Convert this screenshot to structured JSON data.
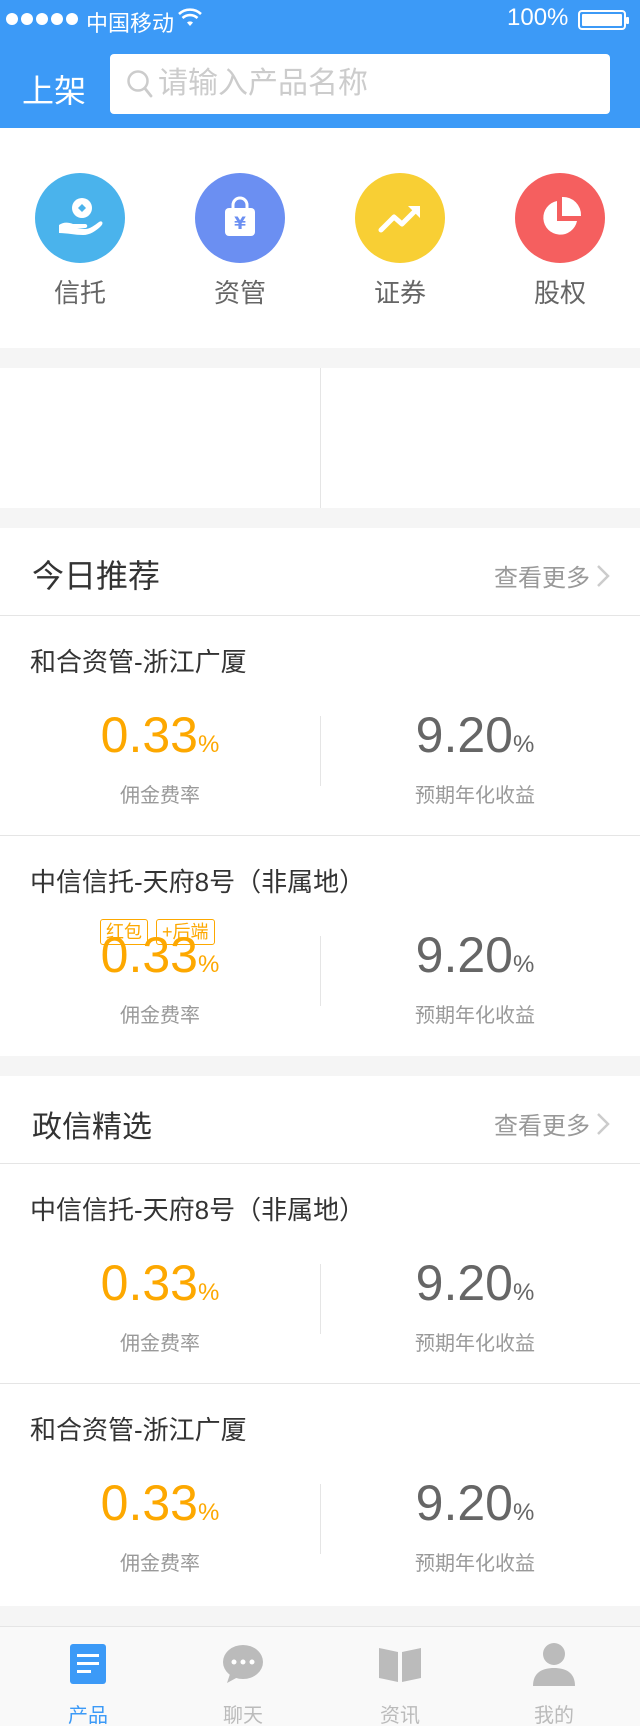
{
  "status_bar": {
    "carrier": "中国移动",
    "battery": "100%"
  },
  "header": {
    "title": "上架",
    "search_placeholder": "请输入产品名称"
  },
  "categories": [
    {
      "label": "信托",
      "icon": "hand-coin-icon",
      "color": "#4ab3ec"
    },
    {
      "label": "资管",
      "icon": "money-bag-icon",
      "color": "#6b8ff2"
    },
    {
      "label": "证券",
      "icon": "trend-up-icon",
      "color": "#f8cf34"
    },
    {
      "label": "股权",
      "icon": "pie-chart-icon",
      "color": "#f55f5f"
    }
  ],
  "recommend": {
    "title": "今日推荐",
    "more": "查看更多",
    "items": [
      {
        "name": "和合资管-浙江广厦",
        "rate": "0.33",
        "rate_unit": "%",
        "rate_label": "佣金费率",
        "yield": "9.20",
        "yield_unit": "%",
        "yield_label": "预期年化收益"
      },
      {
        "name": "中信信托-天府8号（非属地）",
        "tags": [
          "红包",
          "+后端"
        ],
        "rate": "0.33",
        "rate_unit": "%",
        "rate_label": "佣金费率",
        "yield": "9.20",
        "yield_unit": "%",
        "yield_label": "预期年化收益"
      }
    ]
  },
  "selection": {
    "title": "政信精选",
    "more": "查看更多",
    "items": [
      {
        "name": "中信信托-天府8号（非属地）",
        "rate": "0.33",
        "rate_unit": "%",
        "rate_label": "佣金费率",
        "yield": "9.20",
        "yield_unit": "%",
        "yield_label": "预期年化收益"
      },
      {
        "name": "和合资管-浙江广厦",
        "rate": "0.33",
        "rate_unit": "%",
        "rate_label": "佣金费率",
        "yield": "9.20",
        "yield_unit": "%",
        "yield_label": "预期年化收益"
      }
    ]
  },
  "tabbar": {
    "items": [
      {
        "label": "产品",
        "icon": "document-icon",
        "active": true
      },
      {
        "label": "聊天",
        "icon": "chat-icon",
        "active": false
      },
      {
        "label": "资讯",
        "icon": "book-icon",
        "active": false
      },
      {
        "label": "我的",
        "icon": "user-icon",
        "active": false
      }
    ]
  },
  "colors": {
    "primary": "#3c9af7",
    "accent": "#fda800",
    "divider": "#e5e5e5",
    "text": "#333333",
    "muted": "#999999",
    "tabbar_bg": "#f9f9f9"
  }
}
